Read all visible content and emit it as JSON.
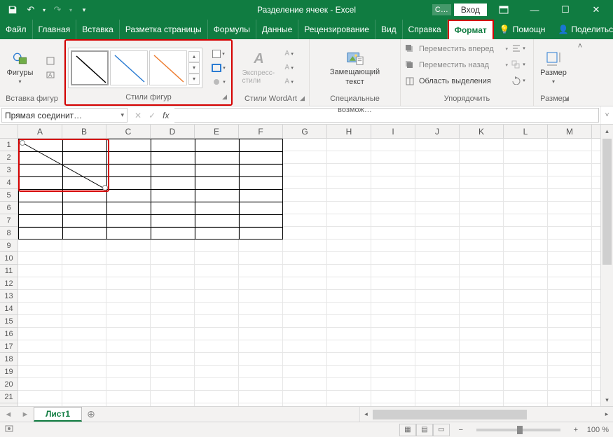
{
  "titlebar": {
    "title": "Разделение ячеек  -  Excel",
    "context_label": "С…",
    "login": "Вход"
  },
  "tabs": [
    "Файл",
    "Главная",
    "Вставка",
    "Разметка страницы",
    "Формулы",
    "Данные",
    "Рецензирование",
    "Вид",
    "Справка",
    "Формат"
  ],
  "active_tab": "Формат",
  "tell_me": "Помощн",
  "share": "Поделиться",
  "ribbon": {
    "insert_shapes_group": "Вставка фигур",
    "shapes_btn": "Фигуры",
    "shape_styles_group": "Стили фигур",
    "wordart_group": "Стили WordArt",
    "express_styles": "Экспресс-стили",
    "alt_text_group": "Специальные возмож…",
    "alt_text_btn_line1": "Замещающий",
    "alt_text_btn_line2": "текст",
    "arrange_group": "Упорядочить",
    "bring_forward": "Переместить вперед",
    "send_backward": "Переместить назад",
    "selection_pane": "Область выделения",
    "size_group": "Размер",
    "size_btn": "Размер"
  },
  "namebox": "Прямая соединит…",
  "columns": [
    "A",
    "B",
    "C",
    "D",
    "E",
    "F",
    "G",
    "H",
    "I",
    "J",
    "K",
    "L",
    "M"
  ],
  "rows_visible": 21,
  "sheet_tab": "Лист1",
  "status": {
    "zoom": "100 %"
  },
  "colors": {
    "brand": "#107c41",
    "highlight": "#d50000"
  }
}
